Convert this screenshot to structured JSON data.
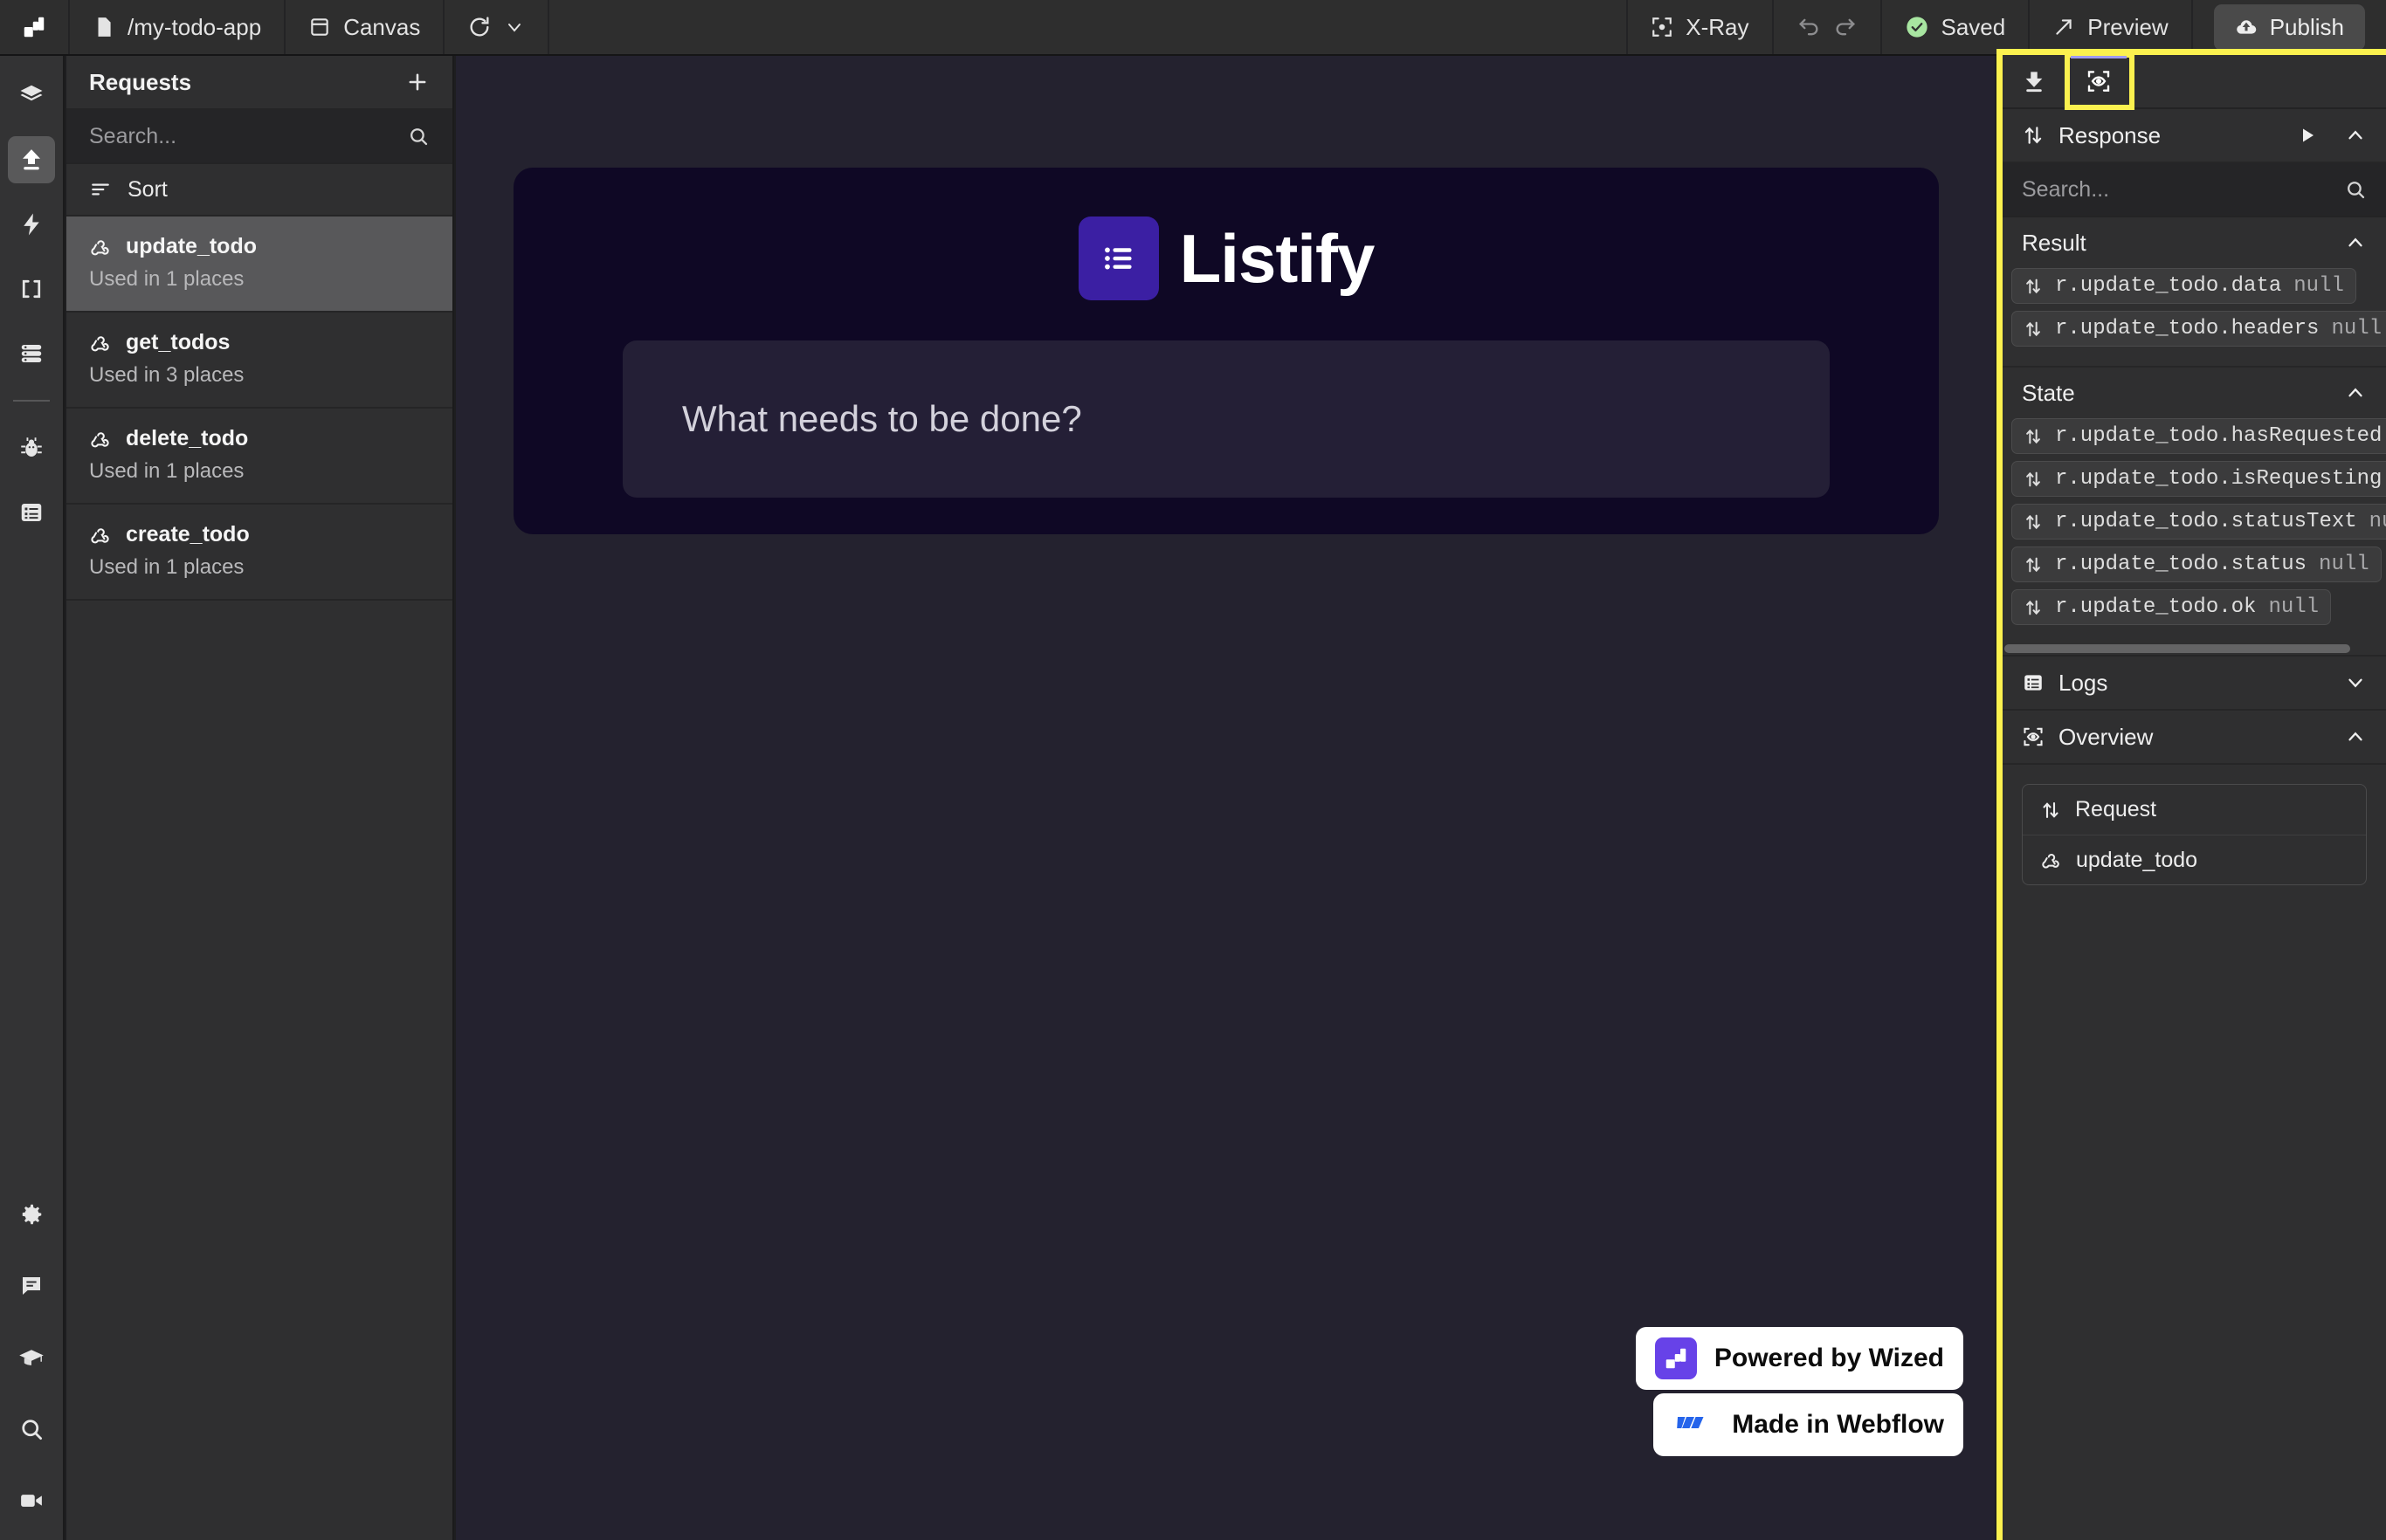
{
  "topbar": {
    "logo_icon": "wized-logo-icon",
    "page": {
      "icon": "file-icon",
      "label": "/my-todo-app"
    },
    "canvas": {
      "icon": "frame-icon",
      "label": "Canvas"
    },
    "reload_icon": "refresh-icon",
    "reload_caret_icon": "chevron-down-icon",
    "xray": {
      "icon": "xray-icon",
      "label": "X-Ray"
    },
    "undo_icon": "undo-icon",
    "redo_icon": "redo-icon",
    "saved": {
      "icon": "check-circle-icon",
      "label": "Saved",
      "color": "#a8e6a1"
    },
    "preview": {
      "icon": "expand-arrow-icon",
      "label": "Preview"
    },
    "publish": {
      "icon": "cloud-upload-icon",
      "label": "Publish"
    }
  },
  "rail": {
    "top_items": [
      {
        "name": "layers",
        "icon": "layers-icon",
        "active": false
      },
      {
        "name": "requests",
        "icon": "upload-icon",
        "active": true
      },
      {
        "name": "events",
        "icon": "lightning-icon",
        "active": false
      },
      {
        "name": "variables",
        "icon": "brackets-icon",
        "active": false
      },
      {
        "name": "data-store",
        "icon": "database-icon",
        "active": false
      }
    ],
    "mid_items": [
      {
        "name": "debug",
        "icon": "bug-icon",
        "active": false
      },
      {
        "name": "logs",
        "icon": "list-box-icon",
        "active": false
      }
    ],
    "bottom_items": [
      {
        "name": "settings",
        "icon": "gear-icon"
      },
      {
        "name": "chat",
        "icon": "chat-bubble-icon"
      },
      {
        "name": "academy",
        "icon": "graduation-cap-icon"
      },
      {
        "name": "search",
        "icon": "search-icon"
      },
      {
        "name": "video",
        "icon": "video-camera-icon"
      }
    ]
  },
  "requests_panel": {
    "title": "Requests",
    "add_icon": "plus-icon",
    "search": {
      "placeholder": "Search...",
      "value": "",
      "icon": "search-icon"
    },
    "sort": {
      "label": "Sort",
      "icon": "sort-icon"
    },
    "items": [
      {
        "name": "update_todo",
        "usage": "Used in 1 places",
        "icon": "webhook-icon",
        "selected": true
      },
      {
        "name": "get_todos",
        "usage": "Used in 3 places",
        "icon": "webhook-icon",
        "selected": false
      },
      {
        "name": "delete_todo",
        "usage": "Used in 1 places",
        "icon": "webhook-icon",
        "selected": false
      },
      {
        "name": "create_todo",
        "usage": "Used in 1 places",
        "icon": "webhook-icon",
        "selected": false
      }
    ]
  },
  "canvas": {
    "app": {
      "logo_icon": "list-icon",
      "title": "Listify",
      "input_placeholder": "What needs to be done?"
    },
    "badges": [
      {
        "label": "Powered by Wized",
        "icon": "wized-badge-icon",
        "accent": "#6742e8"
      },
      {
        "label": "Made in Webflow",
        "icon": "webflow-badge-icon",
        "accent": "#2564eb"
      }
    ]
  },
  "right_panel": {
    "tabs": [
      {
        "name": "download",
        "icon": "download-icon",
        "active": false,
        "highlighted": false
      },
      {
        "name": "overview",
        "icon": "overview-eye-icon",
        "active": true,
        "highlighted": true
      }
    ],
    "response": {
      "label": "Response",
      "icon": "transfer-icon",
      "run_icon": "play-icon",
      "collapse_icon": "chevron-up-icon"
    },
    "search": {
      "placeholder": "Search...",
      "value": "",
      "icon": "search-icon"
    },
    "groups": [
      {
        "title": "Result",
        "collapse_icon": "chevron-up-icon",
        "entries": [
          {
            "icon": "transfer-icon",
            "key": "r.update_todo.data",
            "value": "null"
          },
          {
            "icon": "transfer-icon",
            "key": "r.update_todo.headers",
            "value": "null"
          }
        ]
      },
      {
        "title": "State",
        "collapse_icon": "chevron-up-icon",
        "entries": [
          {
            "icon": "transfer-icon",
            "key": "r.update_todo.hasRequested",
            "value": "false"
          },
          {
            "icon": "transfer-icon",
            "key": "r.update_todo.isRequesting",
            "value": "false"
          },
          {
            "icon": "transfer-icon",
            "key": "r.update_todo.statusText",
            "value": "null"
          },
          {
            "icon": "transfer-icon",
            "key": "r.update_todo.status",
            "value": "null"
          },
          {
            "icon": "transfer-icon",
            "key": "r.update_todo.ok",
            "value": "null"
          }
        ]
      }
    ],
    "logs": {
      "label": "Logs",
      "icon": "list-box-icon",
      "collapse_icon": "chevron-down-icon"
    },
    "overview": {
      "label": "Overview",
      "icon": "overview-eye-icon",
      "collapse_icon": "chevron-up-icon",
      "rows": [
        {
          "icon": "transfer-icon",
          "label": "Request"
        },
        {
          "icon": "webhook-icon",
          "label": "update_todo"
        }
      ]
    }
  },
  "colors": {
    "highlight": "#fbf14f",
    "accent_purple": "#6742e8",
    "tab_active": "#9f9bf0",
    "canvas_bg": "#24222f",
    "app_bg": "#0f0825"
  }
}
